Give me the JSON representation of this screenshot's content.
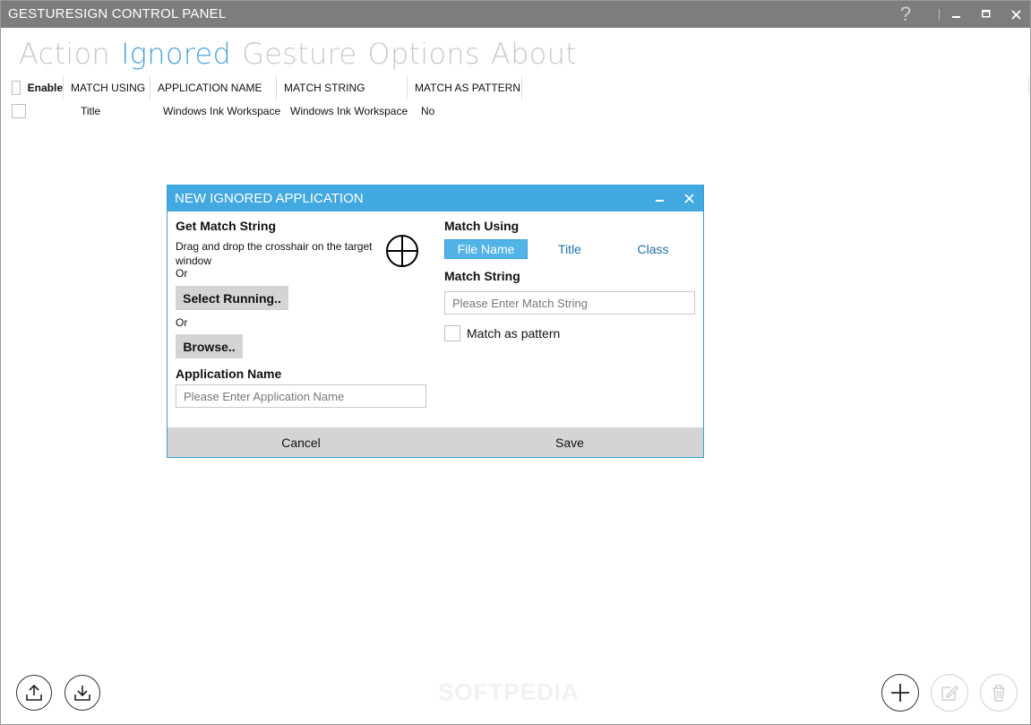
{
  "window": {
    "title": "GESTURESIGN CONTROL PANEL",
    "help": "?"
  },
  "tabs": [
    {
      "label": "Action",
      "active": false
    },
    {
      "label": "Ignored",
      "active": true
    },
    {
      "label": "Gesture",
      "active": false
    },
    {
      "label": "Options",
      "active": false
    },
    {
      "label": "About",
      "active": false
    }
  ],
  "grid": {
    "columns": [
      "Enable",
      "MATCH USING",
      "APPLICATION NAME",
      "MATCH STRING",
      "MATCH AS PATTERN"
    ],
    "rows": [
      {
        "enabled": false,
        "match_using": "Title",
        "application_name": "Windows Ink Workspace",
        "match_string": "Windows Ink Workspace",
        "match_as_pattern": "No"
      }
    ]
  },
  "dialog": {
    "title": "NEW IGNORED APPLICATION",
    "get_match_string": "Get Match String",
    "drag_text": "Drag and drop the crosshair on the target window",
    "or1": "Or",
    "select_running": "Select Running..",
    "or2": "Or",
    "browse": "Browse..",
    "application_name": "Application Name",
    "application_name_placeholder": "Please Enter Application Name",
    "match_using": "Match Using",
    "match_options": [
      "File Name",
      "Title",
      "Class"
    ],
    "match_selected": "File Name",
    "match_string": "Match String",
    "match_string_placeholder": "Please Enter Match String",
    "match_as_pattern": "Match as pattern",
    "match_as_pattern_checked": false,
    "cancel": "Cancel",
    "save": "Save"
  },
  "watermark": "SOFTPEDIA",
  "colors": {
    "accent": "#42a9e0",
    "titlebar": "#7d7d7d",
    "active_tab": "#4ba6d7"
  },
  "icons": [
    "export-icon",
    "import-icon",
    "add-icon",
    "edit-icon",
    "delete-icon"
  ]
}
